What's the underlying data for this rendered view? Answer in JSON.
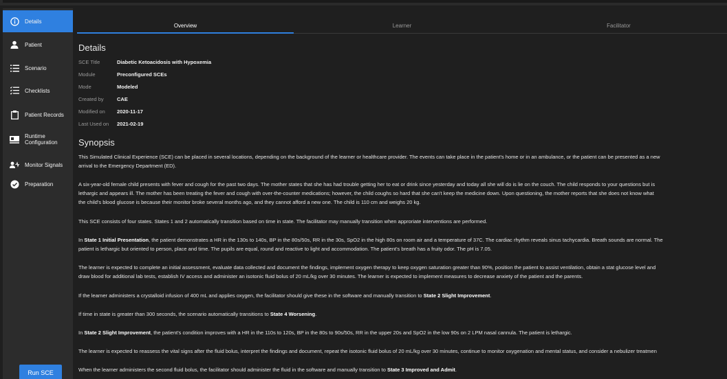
{
  "sidebar": {
    "items": [
      {
        "label": "Details",
        "icon": "info-icon"
      },
      {
        "label": "Patient",
        "icon": "person-icon"
      },
      {
        "label": "Scenario",
        "icon": "list-icon"
      },
      {
        "label": "Checklists",
        "icon": "checklist-icon"
      },
      {
        "label": "Patient Records",
        "icon": "clipboard-icon"
      },
      {
        "label": "Runtime",
        "label2": "Configuration",
        "icon": "runtime-config-icon"
      },
      {
        "label": "Monitor Signals",
        "icon": "monitor-signals-icon"
      },
      {
        "label": "Preparation",
        "icon": "check-circle-icon"
      }
    ],
    "run_button": "Run SCE"
  },
  "tabs": [
    {
      "label": "Overview",
      "active": true
    },
    {
      "label": "Learner",
      "active": false
    },
    {
      "label": "Facilitator",
      "active": false
    }
  ],
  "details": {
    "heading": "Details",
    "rows": [
      {
        "label": "SCE Title",
        "value": "Diabetic Ketoacidosis with Hypoxemia"
      },
      {
        "label": "Module",
        "value": "Preconfigured SCEs"
      },
      {
        "label": "Mode",
        "value": "Modeled"
      },
      {
        "label": "Created by",
        "value": "CAE"
      },
      {
        "label": "Modified on",
        "value": "2020-11-17"
      },
      {
        "label": "Last Used on",
        "value": "2021-02-19"
      }
    ]
  },
  "synopsis": {
    "heading": "Synopsis",
    "p1": {
      "l1": "This Simulated Clinical Experience (SCE) can be placed in several locations, depending on the background of the learner or healthcare provider. The events can take place in the patient's home or in an ambulance, or the patient can be presented as a new",
      "l2": "arrival to the Emergency Department (ED)."
    },
    "p2": {
      "l1": "A six-year-old female child presents with fever and cough for the past two days. The mother states that she has had trouble getting her to eat or drink since yesterday and today all she will do is lie on the couch. The child responds to your questions but is",
      "l2": "lethargic and appears ill. The mother has been treating the fever and cough with over-the-counter medications; however, the child coughs so hard that she can't keep the medicine down. Upon questioning, the mother reports that she does not know what",
      "l3": "the child's blood glucose is because their monitor broke several months ago, and they cannot afford a new one. The child is 110 cm and weighs 20 kg."
    },
    "p3": "This SCE consists of four states. States 1 and 2 automatically transition based on time in state. The facilitator may manually transition when approriate interventions are performed.",
    "p4": {
      "pre": "In ",
      "bold": "State 1 Initial Presentation",
      "post": ", the patient demonstrates a HR in the 130s to 140s, BP in the 80s/50s, RR in the 30s, SpO2 in the high 80s on room air and a temperature of 37C. The cardiac rhythm reveals sinus tachycardia. Breath sounds are normal. The",
      "l2": "patient is lethargic but oriented to person, place and time. The pupils are equal, round and reactive to light and accommodation. The patient's breath has a fruity odor. The pH is 7.05."
    },
    "p5": {
      "l1": "The learner is expected to complete an initial assessment, evaluate data collected and document the findings, implement oxygen therapy to keep oxygen saturation greater than 90%, position the patient to assist ventilation, obtain a stat glucose level and",
      "l2": "draw blood for additional lab tests, establish IV access and administer an isotonic fluid bolus of 20 mL/kg over 30 minutes. The learner is expected to implement measures to decrease anxiety of the patient and the parents."
    },
    "p6": {
      "pre": "If the learner administers a crystalloid infusion of 400 mL and applies oxygen, the facilitator should give these in the software and manually transition to ",
      "bold": "State 2 Slight Improvement",
      "post": "."
    },
    "p7": {
      "pre": "If time in state is greater than 300 seconds, the scenario automatically transitions to ",
      "bold": "State 4 Worsening",
      "post": "."
    },
    "p8": {
      "pre": "In ",
      "bold": "State 2 Slight Improvement",
      "post": ", the patient's condition improves with a HR in the 110s to 120s, BP in the 80s to 90s/50s, RR in the upper 20s and SpO2 in the low 90s on 2 LPM nasal cannula. The patient is lethargic."
    },
    "p9": "The learner is expected to reassess the vital signs after the fluid bolus, interpret the findings and document, repeat the isotonic fluid bolus of 20 mL/kg over 30 minutes, continue to monitor oxygenation and mental status, and consider a nebulizer treatmen",
    "p10": {
      "pre": "When the learner administers the second fluid bolus, the facilitator should administer the fluid in the software and manually transition to ",
      "bold": "State 3 Improved and Admit",
      "post": "."
    }
  },
  "colors": {
    "accent": "#2f80e0",
    "sidebar_bg": "#2c2c2c",
    "main_bg": "#1f1f1f"
  }
}
